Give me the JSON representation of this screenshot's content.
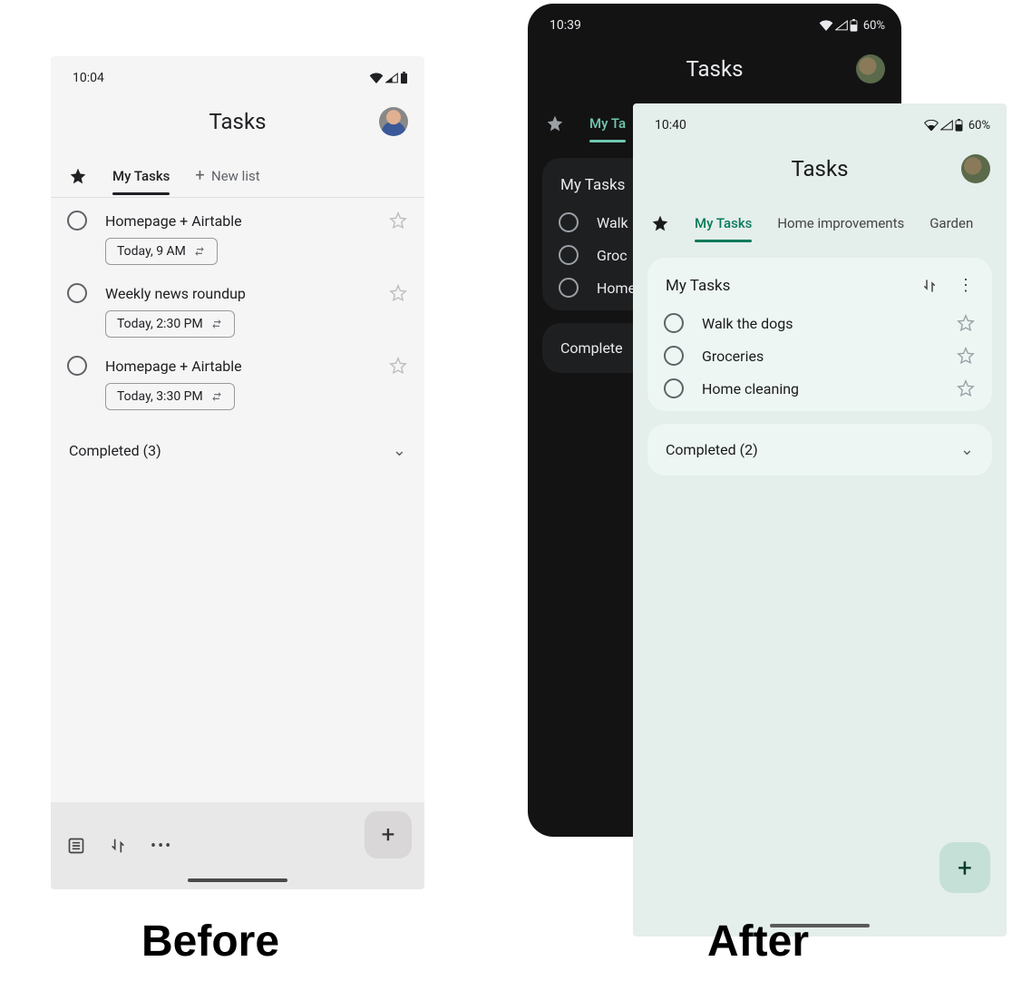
{
  "captions": {
    "before": "Before",
    "after": "After"
  },
  "before": {
    "status": {
      "time": "10:04"
    },
    "header": {
      "title": "Tasks"
    },
    "tabs": {
      "active": "My Tasks",
      "new_list": "New list"
    },
    "tasks": [
      {
        "title": "Homepage + Airtable",
        "chip": "Today, 9 AM"
      },
      {
        "title": "Weekly news roundup",
        "chip": "Today, 2:30 PM"
      },
      {
        "title": "Homepage + Airtable",
        "chip": "Today, 3:30 PM"
      }
    ],
    "completed_label": "Completed (3)"
  },
  "dark": {
    "status": {
      "time": "10:39",
      "battery": "60%"
    },
    "header": {
      "title": "Tasks"
    },
    "tabs": {
      "active": "My Ta"
    },
    "card": {
      "title": "My Tasks",
      "tasks": [
        {
          "title": "Walk"
        },
        {
          "title": "Groc"
        },
        {
          "title": "Home"
        }
      ]
    },
    "completed_label": "Complete"
  },
  "after": {
    "status": {
      "time": "10:40",
      "battery": "60%"
    },
    "header": {
      "title": "Tasks"
    },
    "tabs": {
      "active": "My Tasks",
      "items": [
        "Home improvements",
        "Garden"
      ]
    },
    "card": {
      "title": "My Tasks",
      "tasks": [
        {
          "title": "Walk the dogs"
        },
        {
          "title": "Groceries"
        },
        {
          "title": "Home cleaning"
        }
      ]
    },
    "completed_label": "Completed (2)"
  }
}
